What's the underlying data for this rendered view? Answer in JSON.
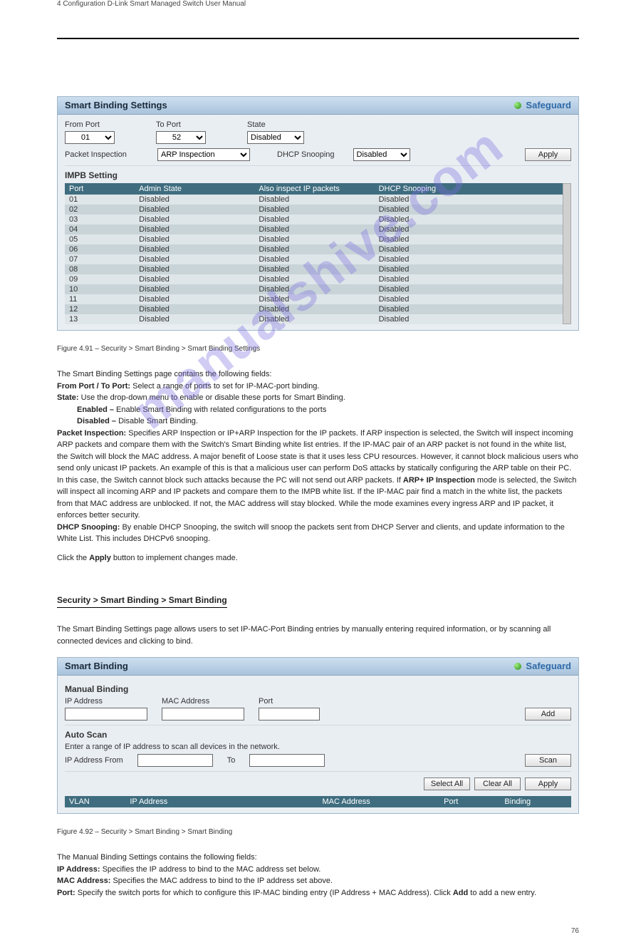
{
  "doc": {
    "header": "4 Configuration    D-Link Smart Managed Switch User Manual",
    "pageNumber": "76"
  },
  "panel1": {
    "title": "Smart Binding Settings",
    "safeguard": "Safeguard",
    "fromPort": {
      "label": "From Port",
      "value": "01"
    },
    "toPort": {
      "label": "To Port",
      "value": "52"
    },
    "state": {
      "label": "State",
      "value": "Disabled"
    },
    "packetInspection": {
      "label": "Packet Inspection",
      "value": "ARP Inspection"
    },
    "dhcpSnoop": {
      "label": "DHCP Snooping",
      "value": "Disabled"
    },
    "applyBtn": "Apply",
    "tableTitle": "IMPB Setting",
    "cols": [
      "Port",
      "Admin State",
      "Also inspect IP packets",
      "DHCP Snooping"
    ],
    "rows": [
      [
        "01",
        "Disabled",
        "Disabled",
        "Disabled"
      ],
      [
        "02",
        "Disabled",
        "Disabled",
        "Disabled"
      ],
      [
        "03",
        "Disabled",
        "Disabled",
        "Disabled"
      ],
      [
        "04",
        "Disabled",
        "Disabled",
        "Disabled"
      ],
      [
        "05",
        "Disabled",
        "Disabled",
        "Disabled"
      ],
      [
        "06",
        "Disabled",
        "Disabled",
        "Disabled"
      ],
      [
        "07",
        "Disabled",
        "Disabled",
        "Disabled"
      ],
      [
        "08",
        "Disabled",
        "Disabled",
        "Disabled"
      ],
      [
        "09",
        "Disabled",
        "Disabled",
        "Disabled"
      ],
      [
        "10",
        "Disabled",
        "Disabled",
        "Disabled"
      ],
      [
        "11",
        "Disabled",
        "Disabled",
        "Disabled"
      ],
      [
        "12",
        "Disabled",
        "Disabled",
        "Disabled"
      ],
      [
        "13",
        "Disabled",
        "Disabled",
        "Disabled"
      ]
    ]
  },
  "fig1": "Figure 4.91 – Security > Smart Binding > Smart Binding Settings",
  "text": {
    "p1a": "The Smart Binding Settings page contains the following fields:",
    "p1b": "From Port / To Port:",
    "p1c": " Select a range of ports to set for IP-MAC-port binding.",
    "p2a": "State:",
    "p2b": " Use the drop-down menu to enable or disable these ports for Smart Binding.",
    "p3a": "Enabled –",
    "p3b": "Enable Smart Binding with related configurations to the ports",
    "p4a": "Disabled –",
    "p4b": "Disable Smart Binding.",
    "p5a": "Packet Inspection:",
    "p5b": " Specifies ARP Inspection or IP+ARP Inspection for the IP packets. If ARP inspection is selected, the Switch will inspect incoming ARP packets and compare them with the Switch's Smart Binding white list entries. If the IP-MAC pair of an ARP packet is not found in the white list, the Switch will block the MAC address. A major benefit of Loose state is that it uses less CPU resources. However, it cannot block malicious users who send only unicast IP packets. An example of this is that a malicious user can perform DoS attacks by statically configuring the ARP table on their PC. In this case, the Switch cannot block such attacks because the PC will not send out ARP packets. If ",
    "p5c": "ARP+ IP Inspection",
    "p5d": " mode is selected, the Switch will inspect all incoming ARP and IP packets and compare them to the IMPB white list. If the IP-MAC pair find a match in the white list, the packets from that MAC address are unblocked. If not, the MAC address will stay blocked. While the mode examines every ingress ARP and IP packet, it enforces better security.",
    "p6a": "DHCP Snooping:",
    "p6b": " By enable DHCP Snooping, the switch will snoop the packets sent from DHCP Server and clients, and update information to the White List. This includes DHCPv6 snooping.",
    "p7": "Click the ",
    "p7b": "Apply",
    "p7c": " button to implement changes made.",
    "subhead": "Security > Smart Binding > Smart Binding",
    "p8": "The Smart Binding Settings page allows users to set IP-MAC-Port Binding entries by manually entering required information, or by scanning all connected devices and clicking to bind."
  },
  "panel2": {
    "title": "Smart Binding",
    "safeguard": "Safeguard",
    "manual": {
      "title": "Manual Binding",
      "ip": "IP Address",
      "mac": "MAC Address",
      "port": "Port",
      "addBtn": "Add"
    },
    "auto": {
      "title": "Auto Scan",
      "desc": "Enter a range of IP address to scan all devices in the network.",
      "fromLbl": "IP Address From",
      "toLbl": "To",
      "scanBtn": "Scan"
    },
    "btns": {
      "selectAll": "Select All",
      "clearAll": "Clear All",
      "apply": "Apply"
    },
    "cols": [
      "VLAN",
      "IP Address",
      "MAC Address",
      "Port",
      "Binding"
    ]
  },
  "fig2": "Figure 4.92 – Security > Smart Binding > Smart Binding",
  "footer": {
    "p1": "The Manual Binding Settings contains the following fields:",
    "p2a": "IP Address:",
    "p2b": " Specifies the IP address to bind to the MAC address set below.",
    "p3a": "MAC Address:",
    "p3b": " Specifies the MAC address to bind to the IP address set above.",
    "p4a": "Port:",
    "p4b": " Specify the switch ports for which to configure this IP-MAC binding entry (IP Address + MAC Address). Click ",
    "p4c": "Add",
    "p4d": " to add a new entry."
  },
  "watermark": "manualshive.com"
}
